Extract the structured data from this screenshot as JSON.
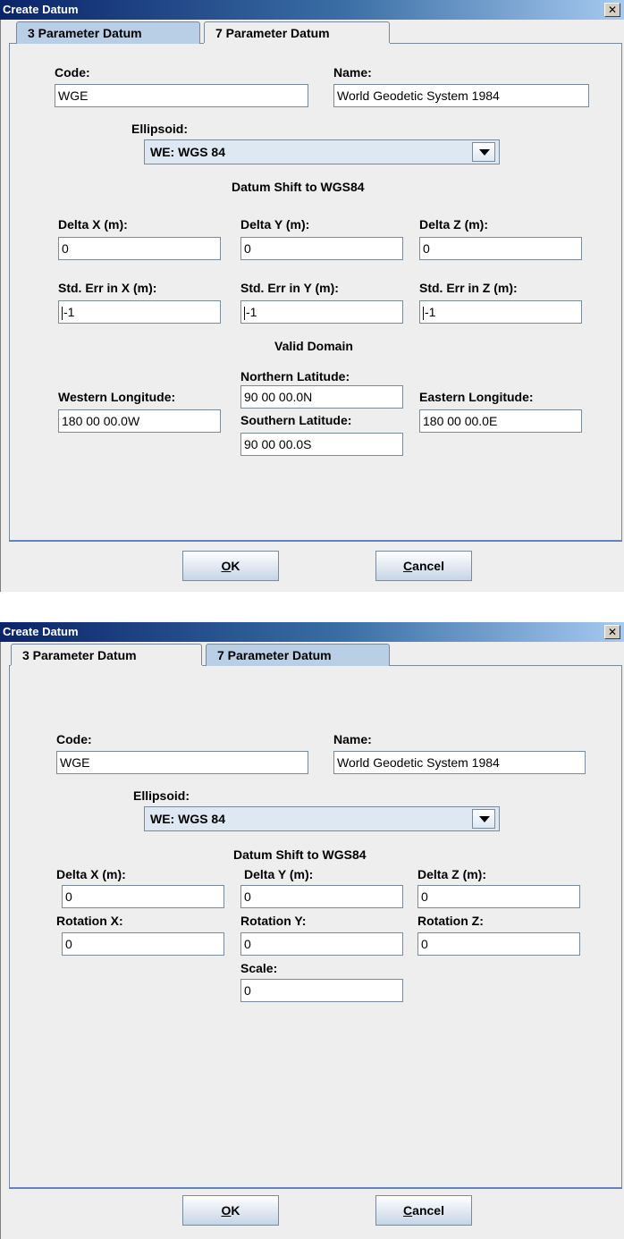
{
  "dialog1": {
    "title": "Create Datum",
    "close_glyph": "✕",
    "tabs": [
      "3 Parameter Datum",
      "7 Parameter Datum"
    ],
    "active_tab": 0,
    "code": {
      "label": "Code:",
      "value": "WGE"
    },
    "name": {
      "label": "Name:",
      "value": "World Geodetic System  1984"
    },
    "ellipsoid": {
      "label": "Ellipsoid:",
      "value": "WE:  WGS 84"
    },
    "datum_shift_title": "Datum Shift to WGS84",
    "delta_x": {
      "label": "Delta X (m):",
      "value": "0"
    },
    "delta_y": {
      "label": "Delta Y (m):",
      "value": "0"
    },
    "delta_z": {
      "label": "Delta Z (m):",
      "value": "0"
    },
    "stderr_x": {
      "label": "Std. Err in X (m):",
      "value": "-1"
    },
    "stderr_y": {
      "label": "Std. Err in Y (m):",
      "value": "-1"
    },
    "stderr_z": {
      "label": "Std. Err in Z (m):",
      "value": "-1"
    },
    "valid_domain_title": "Valid Domain",
    "northern_latitude": {
      "label": "Northern Latitude:",
      "value": "90 00 00.0N"
    },
    "western_longitude": {
      "label": "Western Longitude:",
      "value": "180 00 00.0W"
    },
    "eastern_longitude": {
      "label": "Eastern Longitude:",
      "value": "180 00 00.0E"
    },
    "southern_latitude": {
      "label": "Southern Latitude:",
      "value": "90 00 00.0S"
    },
    "ok": {
      "mnemonic": "O",
      "rest": "K"
    },
    "cancel": {
      "mnemonic": "C",
      "rest": "ancel"
    }
  },
  "dialog2": {
    "title": "Create Datum",
    "close_glyph": "✕",
    "tabs": [
      "3 Parameter Datum",
      "7 Parameter Datum"
    ],
    "active_tab": 1,
    "code": {
      "label": "Code:",
      "value": "WGE"
    },
    "name": {
      "label": "Name:",
      "value": "World Geodetic System  1984"
    },
    "ellipsoid": {
      "label": "Ellipsoid:",
      "value": "WE:  WGS 84"
    },
    "datum_shift_title": "Datum Shift to WGS84",
    "delta_x": {
      "label": "Delta X (m):",
      "value": "0"
    },
    "delta_y": {
      "label": "Delta Y (m):",
      "value": "0"
    },
    "delta_z": {
      "label": "Delta Z (m):",
      "value": "0"
    },
    "rotation_x": {
      "label": "Rotation X:",
      "value": "0"
    },
    "rotation_y": {
      "label": "Rotation Y:",
      "value": "0"
    },
    "rotation_z": {
      "label": "Rotation Z:",
      "value": "0"
    },
    "scale": {
      "label": "Scale:",
      "value": "0"
    },
    "ok": {
      "mnemonic": "O",
      "rest": "K"
    },
    "cancel": {
      "mnemonic": "C",
      "rest": "ancel"
    }
  }
}
